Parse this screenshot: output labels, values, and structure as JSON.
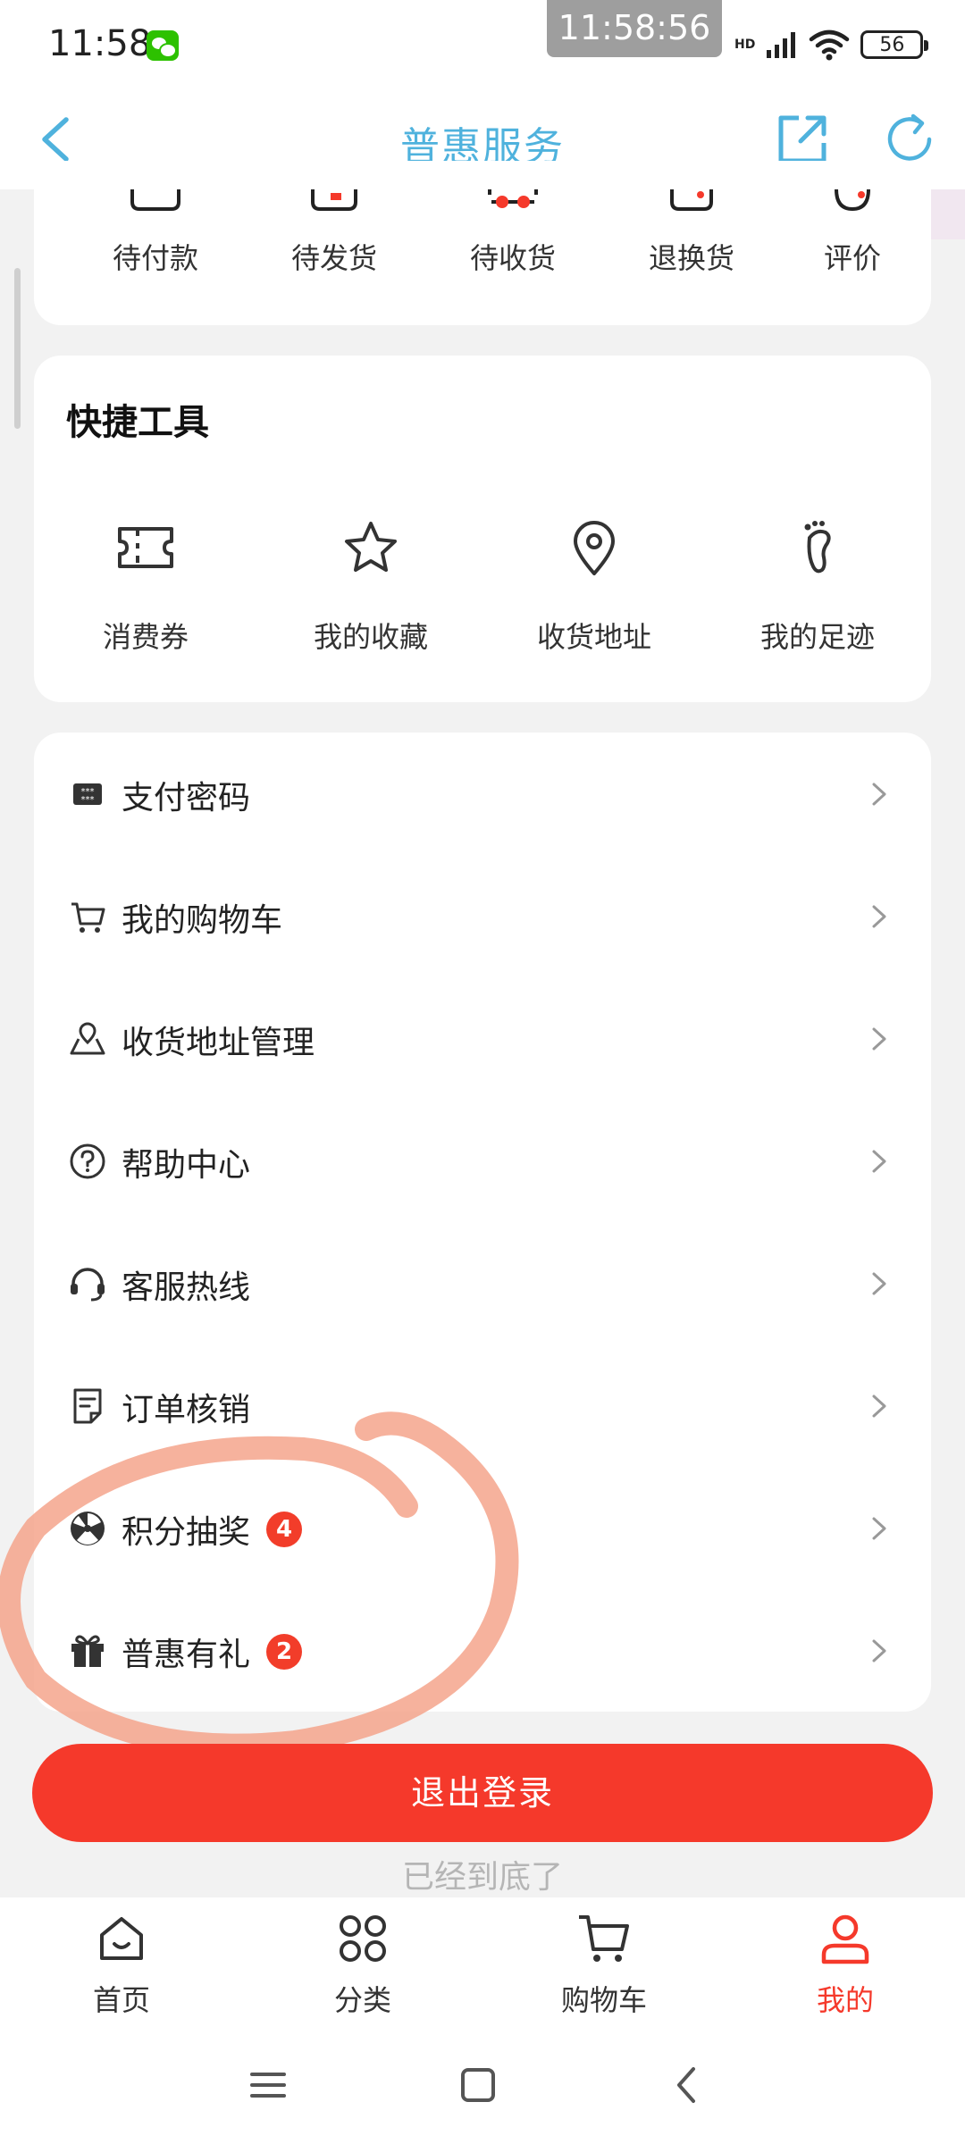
{
  "status_bar": {
    "time": "11:58",
    "clock_overlay": "11:58:56",
    "network": "HD",
    "battery": "56"
  },
  "nav": {
    "title": "普惠服务"
  },
  "orders": {
    "items": [
      {
        "label": "待付款"
      },
      {
        "label": "待发货"
      },
      {
        "label": "待收货"
      },
      {
        "label": "退换货"
      },
      {
        "label": "评价"
      }
    ]
  },
  "tools": {
    "title": "快捷工具",
    "items": [
      {
        "label": "消费券",
        "icon": "coupon-icon"
      },
      {
        "label": "我的收藏",
        "icon": "star-icon"
      },
      {
        "label": "收货地址",
        "icon": "location-pin-icon"
      },
      {
        "label": "我的足迹",
        "icon": "footprint-icon"
      }
    ]
  },
  "menu": {
    "items": [
      {
        "label": "支付密码",
        "icon": "password-keypad-icon"
      },
      {
        "label": "我的购物车",
        "icon": "cart-icon"
      },
      {
        "label": "收货地址管理",
        "icon": "map-pin-icon"
      },
      {
        "label": "帮助中心",
        "icon": "help-icon"
      },
      {
        "label": "客服热线",
        "icon": "headset-icon"
      },
      {
        "label": "订单核销",
        "icon": "order-check-icon"
      },
      {
        "label": "积分抽奖",
        "icon": "lottery-wheel-icon",
        "badge": "4"
      },
      {
        "label": "普惠有礼",
        "icon": "gift-icon",
        "badge": "2"
      }
    ]
  },
  "logout": {
    "label": "退出登录"
  },
  "bottom_hint": "已经到底了",
  "tabbar": {
    "items": [
      {
        "label": "首页",
        "icon": "home-icon"
      },
      {
        "label": "分类",
        "icon": "category-icon"
      },
      {
        "label": "购物车",
        "icon": "cart-icon"
      },
      {
        "label": "我的",
        "icon": "user-icon",
        "active": true
      }
    ]
  },
  "colors": {
    "accent": "#f5392b",
    "nav_title": "#4fb2dd",
    "badge": "#f23d2a",
    "annotation": "#f4a58c"
  }
}
